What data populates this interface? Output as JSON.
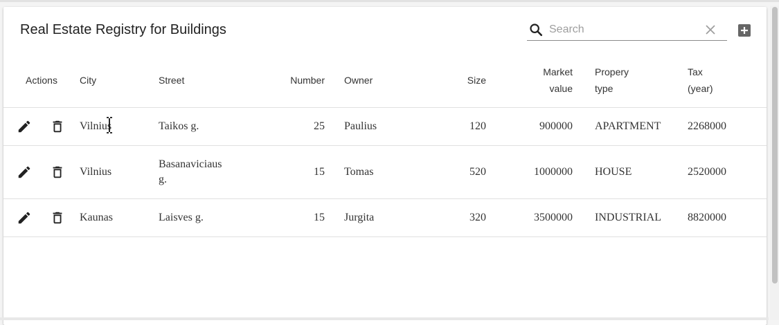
{
  "title": "Real Estate Registry for Buildings",
  "search": {
    "placeholder": "Search",
    "value": ""
  },
  "columns": {
    "actions": "Actions",
    "city": "City",
    "street": "Street",
    "number": "Number",
    "owner": "Owner",
    "size": "Size",
    "market_value_1": "Market",
    "market_value_2": "value",
    "property_type_1": "Propery",
    "property_type_2": "type",
    "tax_1": "Tax",
    "tax_2": "(year)"
  },
  "rows": [
    {
      "city": "Vilnius",
      "street": "Taikos g.",
      "number": "25",
      "owner": "Paulius",
      "size": "120",
      "market_value": "900000",
      "property_type": "APARTMENT",
      "tax": "2268000"
    },
    {
      "city": "Vilnius",
      "street": "Basanaviciaus g.",
      "number": "15",
      "owner": "Tomas",
      "size": "520",
      "market_value": "1000000",
      "property_type": "HOUSE",
      "tax": "2520000"
    },
    {
      "city": "Kaunas",
      "street": "Laisves g.",
      "number": "15",
      "owner": "Jurgita",
      "size": "320",
      "market_value": "3500000",
      "property_type": "INDUSTRIAL",
      "tax": "8820000"
    }
  ],
  "icons": {
    "search": "search-icon",
    "clear": "close-icon",
    "add": "add-box-icon",
    "edit": "pencil-icon",
    "delete": "trash-icon"
  },
  "colors": {
    "icon": "#222222",
    "divider": "#e0e0e0",
    "header_text": "#333333"
  }
}
